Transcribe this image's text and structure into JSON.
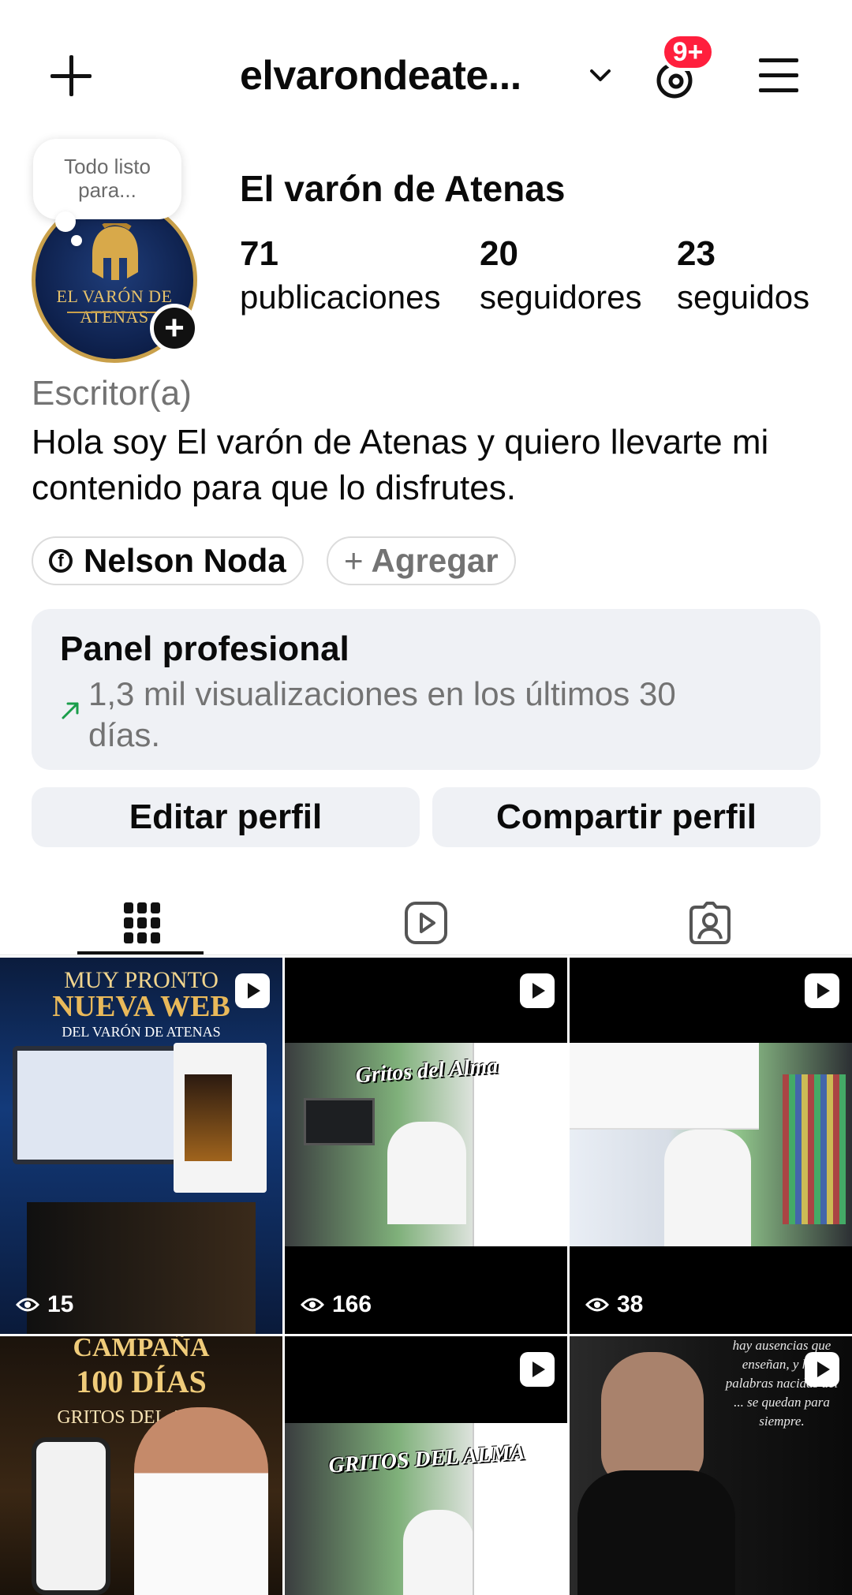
{
  "header": {
    "username": "elvarondeate...",
    "notifications_badge": "9+"
  },
  "profile": {
    "note": "Todo listo para...",
    "avatar_text": "EL VARÓN DE ATENAS",
    "display_name": "El varón de Atenas",
    "stats": [
      {
        "count": "71",
        "label": "publicaciones"
      },
      {
        "count": "20",
        "label": "seguidores"
      },
      {
        "count": "23",
        "label": "seguidos"
      }
    ],
    "category": "Escritor(a)",
    "bio": "Hola soy El varón de Atenas y quiero llevarte mi contenido para que lo disfrutes.",
    "links": {
      "facebook_name": "Nelson Noda",
      "add_label": "Agregar"
    }
  },
  "professional_panel": {
    "title": "Panel profesional",
    "summary": "1,3 mil visualizaciones en los últimos 30 días."
  },
  "actions": {
    "edit": "Editar perfil",
    "share": "Compartir perfil"
  },
  "tabs": [
    "posts-grid",
    "reels",
    "tagged"
  ],
  "posts": [
    {
      "views": "15",
      "title_top": "MUY PRONTO",
      "title_main": "NUEVA WEB",
      "title_sub": "DEL VARÓN DE ATENAS"
    },
    {
      "views": "166",
      "caption": "Gritos del Alma"
    },
    {
      "views": "38"
    },
    {
      "title_top": "CAMPAÑA",
      "title_main": "100 DÍAS",
      "title_sub": "GRITOS DEL ALMA"
    },
    {
      "caption": "GRITOS DEL ALMA"
    },
    {
      "quote": "hay ausencias que enseñan, y hay palabras nacidas del ... se quedan para siempre."
    }
  ],
  "colors": {
    "badge": "#ff1f3d",
    "panel_bg": "#eff1f5",
    "muted_text": "#737373",
    "trend_arrow": "#1a9e4a"
  }
}
